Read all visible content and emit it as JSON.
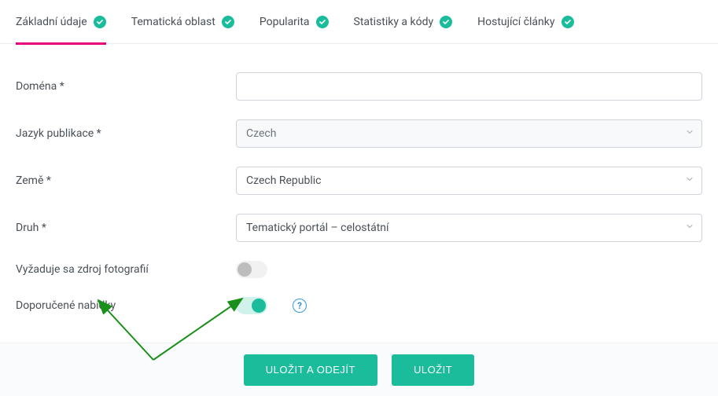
{
  "tabs": [
    {
      "label": "Základní údaje"
    },
    {
      "label": "Tematická oblast"
    },
    {
      "label": "Popularita"
    },
    {
      "label": "Statistiky a kódy"
    },
    {
      "label": "Hostující články"
    }
  ],
  "form": {
    "domain_label": "Doména *",
    "domain_value": "",
    "language_label": "Jazyk publikace *",
    "language_value": "Czech",
    "country_label": "Země *",
    "country_value": "Czech Republic",
    "type_label": "Druh *",
    "type_value": "Tematický portál – celostátní",
    "photo_source_label": "Vyžaduje sa zdroj fotografií",
    "photo_source_on": false,
    "recommended_offers_label": "Doporučené nabídky",
    "recommended_offers_on": true
  },
  "actions": {
    "save_exit_label": "ULOŽIT A ODEJÍT",
    "save_label": "ULOŽIT"
  },
  "colors": {
    "accent_teal": "#1abc9c",
    "accent_pink": "#e6007e",
    "arrow_green": "#1a8f1a"
  }
}
